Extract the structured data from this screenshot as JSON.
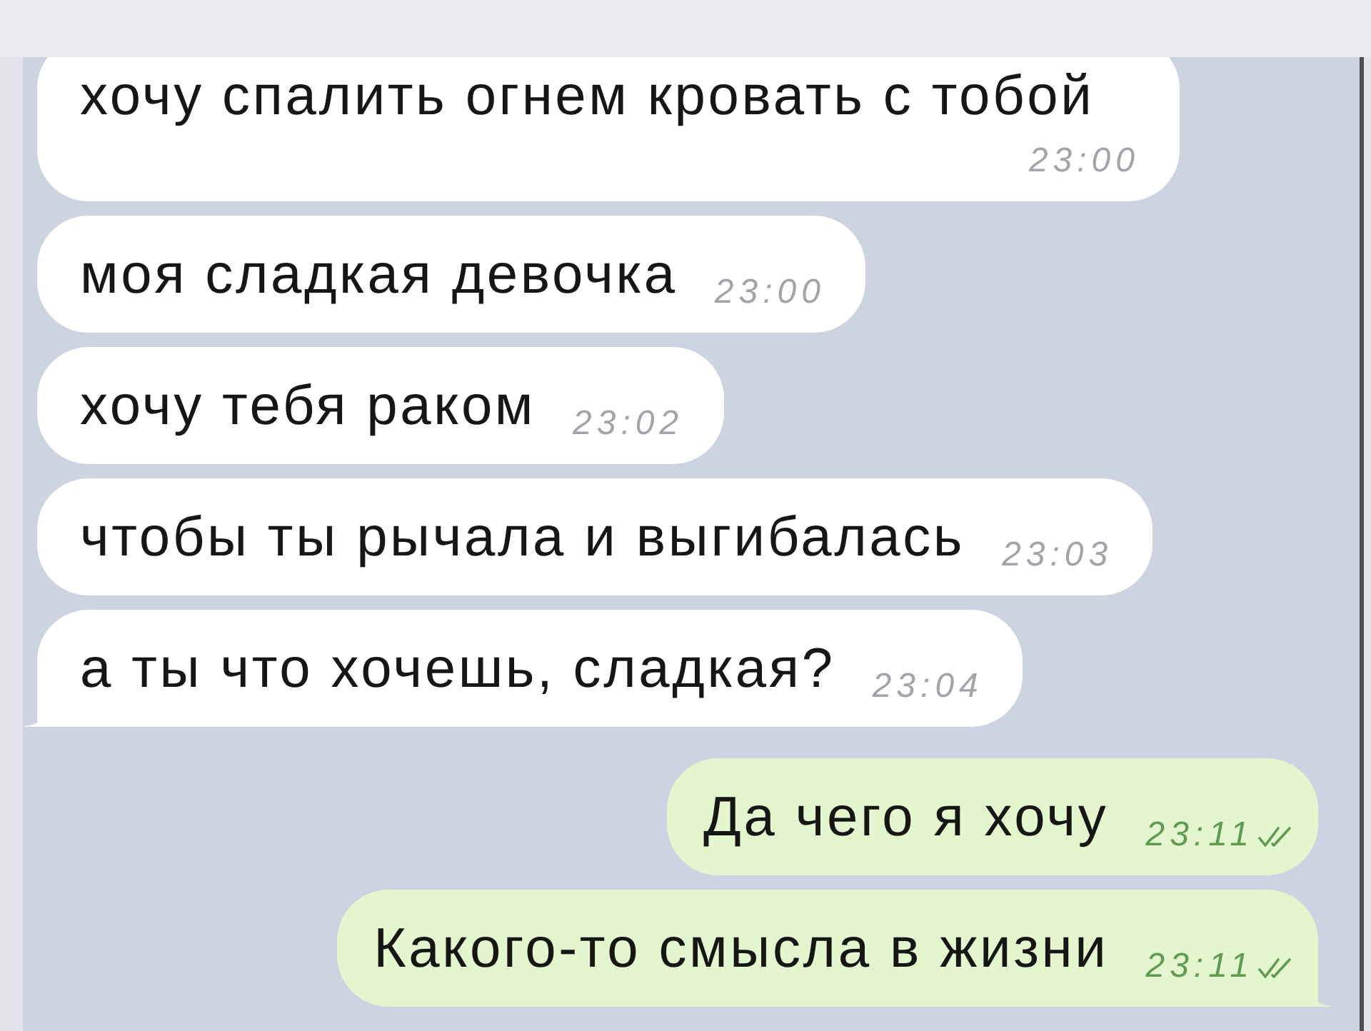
{
  "chat": {
    "messages": [
      {
        "kind": "incoming",
        "text": "хочу спалить огнем кровать с тобой",
        "time": "23:00"
      },
      {
        "kind": "incoming",
        "text": "моя сладкая девочка",
        "time": "23:00"
      },
      {
        "kind": "incoming",
        "text": "хочу тебя раком",
        "time": "23:02"
      },
      {
        "kind": "incoming",
        "text": "чтобы ты рычала и выгибалась",
        "time": "23:03"
      },
      {
        "kind": "incoming",
        "text": "а ты что хочешь, сладкая?",
        "time": "23:04"
      },
      {
        "kind": "outgoing",
        "text": "Да чего я хочу",
        "time": "23:11",
        "read": true
      },
      {
        "kind": "outgoing",
        "text": "Какого-то смысла в жизни",
        "time": "23:11",
        "read": true
      }
    ]
  }
}
